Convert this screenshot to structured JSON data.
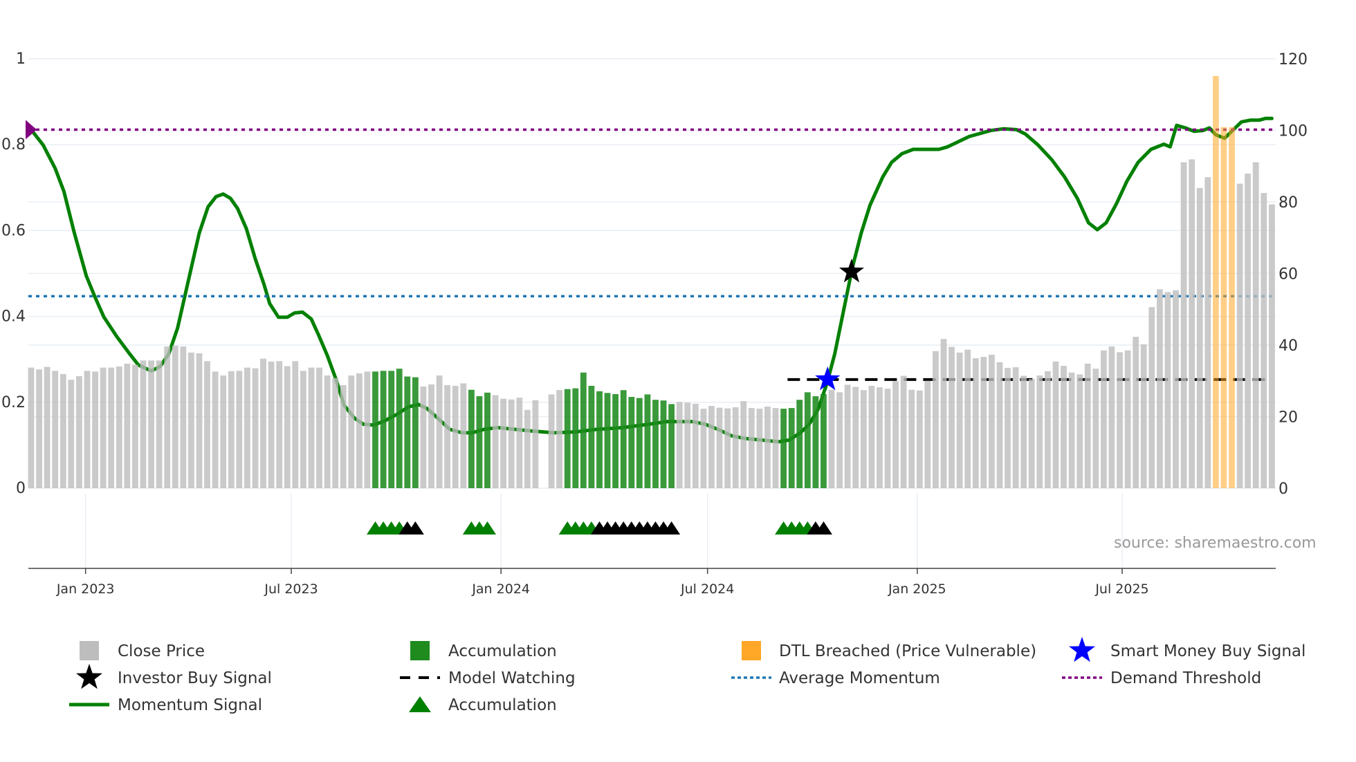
{
  "chart_data": {
    "type": "bar",
    "title": "",
    "x_unit": "week index (weekly bars)",
    "x_ticks": [
      {
        "label": "Jan 2023",
        "week": 6.8
      },
      {
        "label": "Jul 2023",
        "week": 32.5
      },
      {
        "label": "Jan 2024",
        "week": 58.7
      },
      {
        "label": "Jul 2024",
        "week": 84.5
      },
      {
        "label": "Jan 2025",
        "week": 110.7
      },
      {
        "label": "Jul 2025",
        "week": 136.3
      }
    ],
    "left_axis": {
      "range": [
        0,
        1
      ],
      "ticks": [
        "0",
        "0.2",
        "0.4",
        "0.6",
        "0.8",
        "1"
      ],
      "tick_values": [
        0,
        0.2,
        0.4,
        0.6,
        0.8,
        1
      ]
    },
    "right_axis": {
      "range": [
        0,
        120
      ],
      "ticks": [
        "0",
        "20",
        "40",
        "60",
        "80",
        "100",
        "120"
      ],
      "tick_values": [
        0,
        20,
        40,
        60,
        80,
        100,
        120
      ]
    },
    "grid": true,
    "close_price": [
      33.7,
      33.2,
      33.9,
      32.8,
      31.9,
      30.3,
      31.3,
      32.8,
      32.6,
      33.7,
      33.7,
      34,
      34.8,
      34.5,
      35.7,
      35.7,
      35.7,
      39.6,
      39.8,
      39.6,
      37.9,
      37.7,
      35.5,
      32.6,
      31.5,
      32.7,
      32.8,
      33.7,
      33.5,
      36.2,
      35.4,
      35.5,
      34.1,
      35.5,
      32.8,
      33.7,
      33.7,
      31.5,
      30.8,
      28.8,
      31.5,
      32.1,
      32.6,
      32.6,
      32.8,
      32.8,
      33.4,
      31.2,
      31,
      28.4,
      29,
      31.5,
      28.8,
      28.6,
      29.3,
      27.5,
      25.7,
      26.7,
      26,
      25,
      24.8,
      25.3,
      21.9,
      24.6,
      null,
      26.2,
      27.4,
      27.7,
      27.9,
      32.3,
      28.6,
      27.1,
      26.6,
      26.3,
      27.4,
      25.5,
      25.2,
      26.2,
      24.7,
      24.5,
      23.5,
      24.1,
      23.9,
      23.6,
      22.2,
      23,
      22.5,
      22.3,
      22.6,
      24.3,
      22.4,
      22.2,
      22.8,
      22.4,
      22.2,
      22.4,
      24.7,
      26.8,
      25.7,
      26.3,
      27.5,
      26.8,
      28.9,
      28.3,
      27.4,
      28.6,
      28.2,
      27.8,
      29.9,
      31.4,
      27.5,
      27.3,
      30,
      38.3,
      41.7,
      39.5,
      37.9,
      38.7,
      36.3,
      36.7,
      37.3,
      35.2,
      33.6,
      33.8,
      31.4,
      30.5,
      31.5,
      32.7,
      35.4,
      34.2,
      32.3,
      31.8,
      34.8,
      33.4,
      38.5,
      39.6,
      38,
      38.5,
      42.3,
      40.2,
      50.6,
      55.6,
      54.8,
      55.3,
      91.1,
      91.9,
      83.9,
      86.9,
      115.2,
      100.9,
      100.9,
      85.1,
      87.9,
      91.1,
      82.5,
      79.3
    ],
    "accumulation_ranges": [
      [
        43,
        48
      ],
      [
        55,
        57
      ],
      [
        67,
        80
      ],
      [
        94,
        99
      ]
    ],
    "dtl_breached_weeks": [
      148,
      149,
      150
    ],
    "accumulation_markers": {
      "green": [
        43,
        44,
        45,
        46,
        55,
        56,
        57,
        67,
        68,
        69,
        70,
        94,
        95,
        96,
        97
      ],
      "black": [
        47,
        48,
        71,
        72,
        73,
        74,
        75,
        76,
        77,
        78,
        79,
        80,
        98,
        99
      ]
    },
    "momentum_signal": [
      [
        0,
        0.835
      ],
      [
        1.5,
        0.799
      ],
      [
        3,
        0.745
      ],
      [
        4.1,
        0.691
      ],
      [
        5.4,
        0.594
      ],
      [
        6.9,
        0.494
      ],
      [
        8,
        0.444
      ],
      [
        9.1,
        0.398
      ],
      [
        10.7,
        0.353
      ],
      [
        12.3,
        0.313
      ],
      [
        13.4,
        0.287
      ],
      [
        15,
        0.273
      ],
      [
        16.1,
        0.283
      ],
      [
        17.2,
        0.313
      ],
      [
        18.3,
        0.373
      ],
      [
        19.4,
        0.464
      ],
      [
        21,
        0.594
      ],
      [
        22.1,
        0.655
      ],
      [
        23.1,
        0.679
      ],
      [
        24,
        0.685
      ],
      [
        24.9,
        0.675
      ],
      [
        25.8,
        0.651
      ],
      [
        26.9,
        0.604
      ],
      [
        28,
        0.534
      ],
      [
        29.1,
        0.474
      ],
      [
        29.8,
        0.43
      ],
      [
        30.9,
        0.398
      ],
      [
        32,
        0.398
      ],
      [
        32.9,
        0.408
      ],
      [
        33.9,
        0.41
      ],
      [
        35,
        0.394
      ],
      [
        35.9,
        0.357
      ],
      [
        37,
        0.309
      ],
      [
        38.1,
        0.253
      ],
      [
        39.1,
        0.193
      ],
      [
        40.4,
        0.163
      ],
      [
        41.5,
        0.149
      ],
      [
        42.8,
        0.147
      ],
      [
        44.2,
        0.157
      ],
      [
        45.8,
        0.173
      ],
      [
        47.1,
        0.189
      ],
      [
        48.4,
        0.195
      ],
      [
        49.5,
        0.185
      ],
      [
        50.8,
        0.163
      ],
      [
        52.3,
        0.137
      ],
      [
        53.8,
        0.129
      ],
      [
        55.1,
        0.129
      ],
      [
        56.6,
        0.137
      ],
      [
        58.3,
        0.141
      ],
      [
        60.4,
        0.137
      ],
      [
        62.6,
        0.133
      ],
      [
        65.3,
        0.129
      ],
      [
        68,
        0.131
      ],
      [
        70.7,
        0.137
      ],
      [
        73.9,
        0.141
      ],
      [
        77.2,
        0.149
      ],
      [
        79.4,
        0.155
      ],
      [
        82.6,
        0.155
      ],
      [
        84.2,
        0.149
      ],
      [
        85.8,
        0.137
      ],
      [
        87.5,
        0.122
      ],
      [
        89.1,
        0.116
      ],
      [
        91.2,
        0.112
      ],
      [
        93.4,
        0.108
      ],
      [
        94.7,
        0.112
      ],
      [
        96.1,
        0.129
      ],
      [
        97.2,
        0.149
      ],
      [
        98.3,
        0.183
      ],
      [
        99.4,
        0.243
      ],
      [
        100.4,
        0.313
      ],
      [
        101.5,
        0.414
      ],
      [
        102.6,
        0.514
      ],
      [
        103.7,
        0.594
      ],
      [
        104.8,
        0.659
      ],
      [
        106.4,
        0.725
      ],
      [
        107.5,
        0.759
      ],
      [
        108.8,
        0.779
      ],
      [
        110.2,
        0.789
      ],
      [
        111.8,
        0.789
      ],
      [
        113.4,
        0.789
      ],
      [
        114.5,
        0.795
      ],
      [
        117.2,
        0.819
      ],
      [
        119.9,
        0.833
      ],
      [
        121.5,
        0.837
      ],
      [
        123.1,
        0.835
      ],
      [
        124.2,
        0.825
      ],
      [
        125.8,
        0.799
      ],
      [
        127.5,
        0.765
      ],
      [
        129.1,
        0.725
      ],
      [
        130.7,
        0.675
      ],
      [
        132.1,
        0.618
      ],
      [
        133.2,
        0.602
      ],
      [
        134.3,
        0.618
      ],
      [
        135.6,
        0.663
      ],
      [
        136.9,
        0.715
      ],
      [
        138.3,
        0.759
      ],
      [
        139.9,
        0.789
      ],
      [
        141.5,
        0.801
      ],
      [
        142.3,
        0.795
      ],
      [
        143.1,
        0.845
      ],
      [
        144.2,
        0.839
      ],
      [
        145.3,
        0.831
      ],
      [
        146.4,
        0.833
      ],
      [
        147.2,
        0.839
      ],
      [
        148,
        0.823
      ],
      [
        149.1,
        0.815
      ],
      [
        150.2,
        0.835
      ],
      [
        151.2,
        0.853
      ],
      [
        152.3,
        0.857
      ],
      [
        153.4,
        0.857
      ],
      [
        154.2,
        0.861
      ],
      [
        155,
        0.861
      ]
    ],
    "demand_threshold": 0.835,
    "average_momentum": 0.447,
    "model_watching": {
      "from_week": 94.5,
      "to_week": 155,
      "value": 0.253
    },
    "investor_buy_signal": {
      "week": 102.5,
      "value": 0.504
    },
    "smart_money_buy_signal": {
      "week": 99.5,
      "value": 0.253
    },
    "demand_start_marker": {
      "week": 0,
      "value": 0.835
    },
    "legend": {
      "placement": "bottom",
      "items": [
        {
          "label": "Close Price",
          "symbol": "square",
          "color": "#bdbdbd"
        },
        {
          "label": "Accumulation",
          "symbol": "square",
          "color": "#1f8b1f"
        },
        {
          "label": "DTL Breached (Price Vulnerable)",
          "symbol": "square",
          "color": "#ffa726"
        },
        {
          "label": "Smart Money Buy Signal",
          "symbol": "star",
          "color": "#0000ff"
        },
        {
          "label": "Investor Buy Signal",
          "symbol": "star",
          "color": "#000000"
        },
        {
          "label": "Model Watching",
          "symbol": "dash",
          "color": "#000000"
        },
        {
          "label": "Average Momentum",
          "symbol": "dot",
          "color": "#1f77b4"
        },
        {
          "label": "Demand Threshold",
          "symbol": "dot",
          "color": "#800080"
        },
        {
          "label": "Momentum Signal",
          "symbol": "line",
          "color": "#008000"
        },
        {
          "label": "Accumulation",
          "symbol": "triangle",
          "color": "#008000"
        }
      ]
    },
    "source": "source: sharemaestro.com",
    "colors": {
      "price": "#bdbdbd",
      "accumulation": "#1f8b1f",
      "dtl": "#ffa726",
      "momentum": "#008000",
      "average": "#1f77b4",
      "demand": "#800080",
      "watching": "#000000",
      "smart_money": "#0000ff",
      "investor": "#000000",
      "grid": "#e9edf3"
    }
  }
}
